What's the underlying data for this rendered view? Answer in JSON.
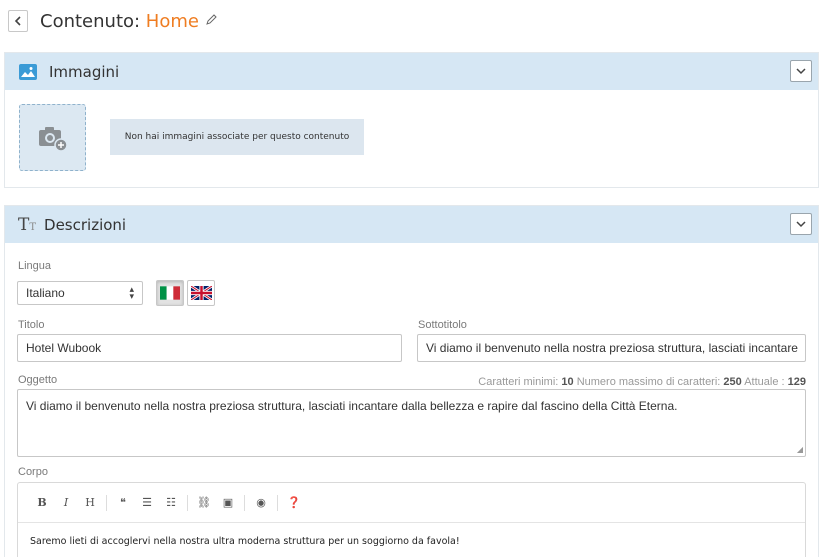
{
  "header": {
    "back_icon": "chevron-left-icon",
    "title_prefix": "Contenuto: ",
    "title_accent": "Home",
    "accent_color": "#ef7d22",
    "edit_icon": "pencil-icon"
  },
  "images_panel": {
    "title": "Immagini",
    "icon": "image-icon",
    "header_bg": "#d6e7f4",
    "upload_icon": "camera-plus-icon",
    "empty_message": "Non hai immagini associate per questo contenuto"
  },
  "descriptions_panel": {
    "title": "Descrizioni",
    "icon": "text-size-icon",
    "language": {
      "label": "Lingua",
      "selected": "Italiano",
      "flags": [
        {
          "name": "italian-flag-icon",
          "active": true
        },
        {
          "name": "uk-flag-icon",
          "active": false
        }
      ]
    },
    "title_field": {
      "label": "Titolo",
      "value": "Hotel Wubook"
    },
    "subtitle_field": {
      "label": "Sottotitolo",
      "value": "Vi diamo il benvenuto nella nostra preziosa struttura, lasciati incantare"
    },
    "subject_field": {
      "label": "Oggetto",
      "value": "Vi diamo il benvenuto nella nostra preziosa struttura, lasciati incantare dalla bellezza e rapire dal fascino della Città Eterna.",
      "min_label": "Caratteri minimi: ",
      "min_value": "10",
      "max_label": " Numero massimo di caratteri: ",
      "max_value": "250",
      "current_label": " Attuale : ",
      "current_value": "129"
    },
    "body_field": {
      "label": "Corpo",
      "toolbar": [
        "B",
        "I",
        "H",
        "❝",
        "☰",
        "☷",
        "⛓",
        "▣",
        "◉",
        "❓"
      ],
      "value": "Saremo lieti di accoglervi nella nostra ultra moderna struttura per un soggiorno da favola!"
    }
  }
}
